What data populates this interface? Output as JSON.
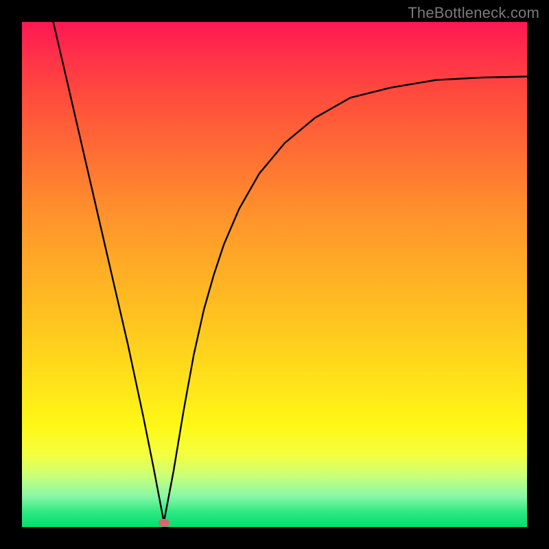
{
  "watermark": {
    "text": "TheBottleneck.com"
  },
  "marker": {
    "x_frac": 0.281,
    "y_frac": 0.992
  },
  "chart_data": {
    "type": "line",
    "title": "",
    "xlabel": "",
    "ylabel": "",
    "xlim": [
      0,
      1
    ],
    "ylim": [
      0,
      1
    ],
    "series": [
      {
        "name": "curve",
        "x": [
          0.062,
          0.09,
          0.12,
          0.15,
          0.18,
          0.21,
          0.24,
          0.26,
          0.281,
          0.3,
          0.32,
          0.34,
          0.36,
          0.38,
          0.4,
          0.43,
          0.47,
          0.52,
          0.58,
          0.65,
          0.73,
          0.82,
          0.91,
          1.0
        ],
        "y": [
          1.0,
          0.88,
          0.75,
          0.62,
          0.49,
          0.36,
          0.22,
          0.12,
          0.01,
          0.11,
          0.23,
          0.34,
          0.43,
          0.5,
          0.56,
          0.63,
          0.7,
          0.76,
          0.81,
          0.85,
          0.87,
          0.885,
          0.89,
          0.892
        ]
      }
    ],
    "marker": {
      "x": 0.281,
      "y": 0.008
    },
    "background_gradient": {
      "top": "#ff1752",
      "bottom": "#00e070"
    }
  }
}
